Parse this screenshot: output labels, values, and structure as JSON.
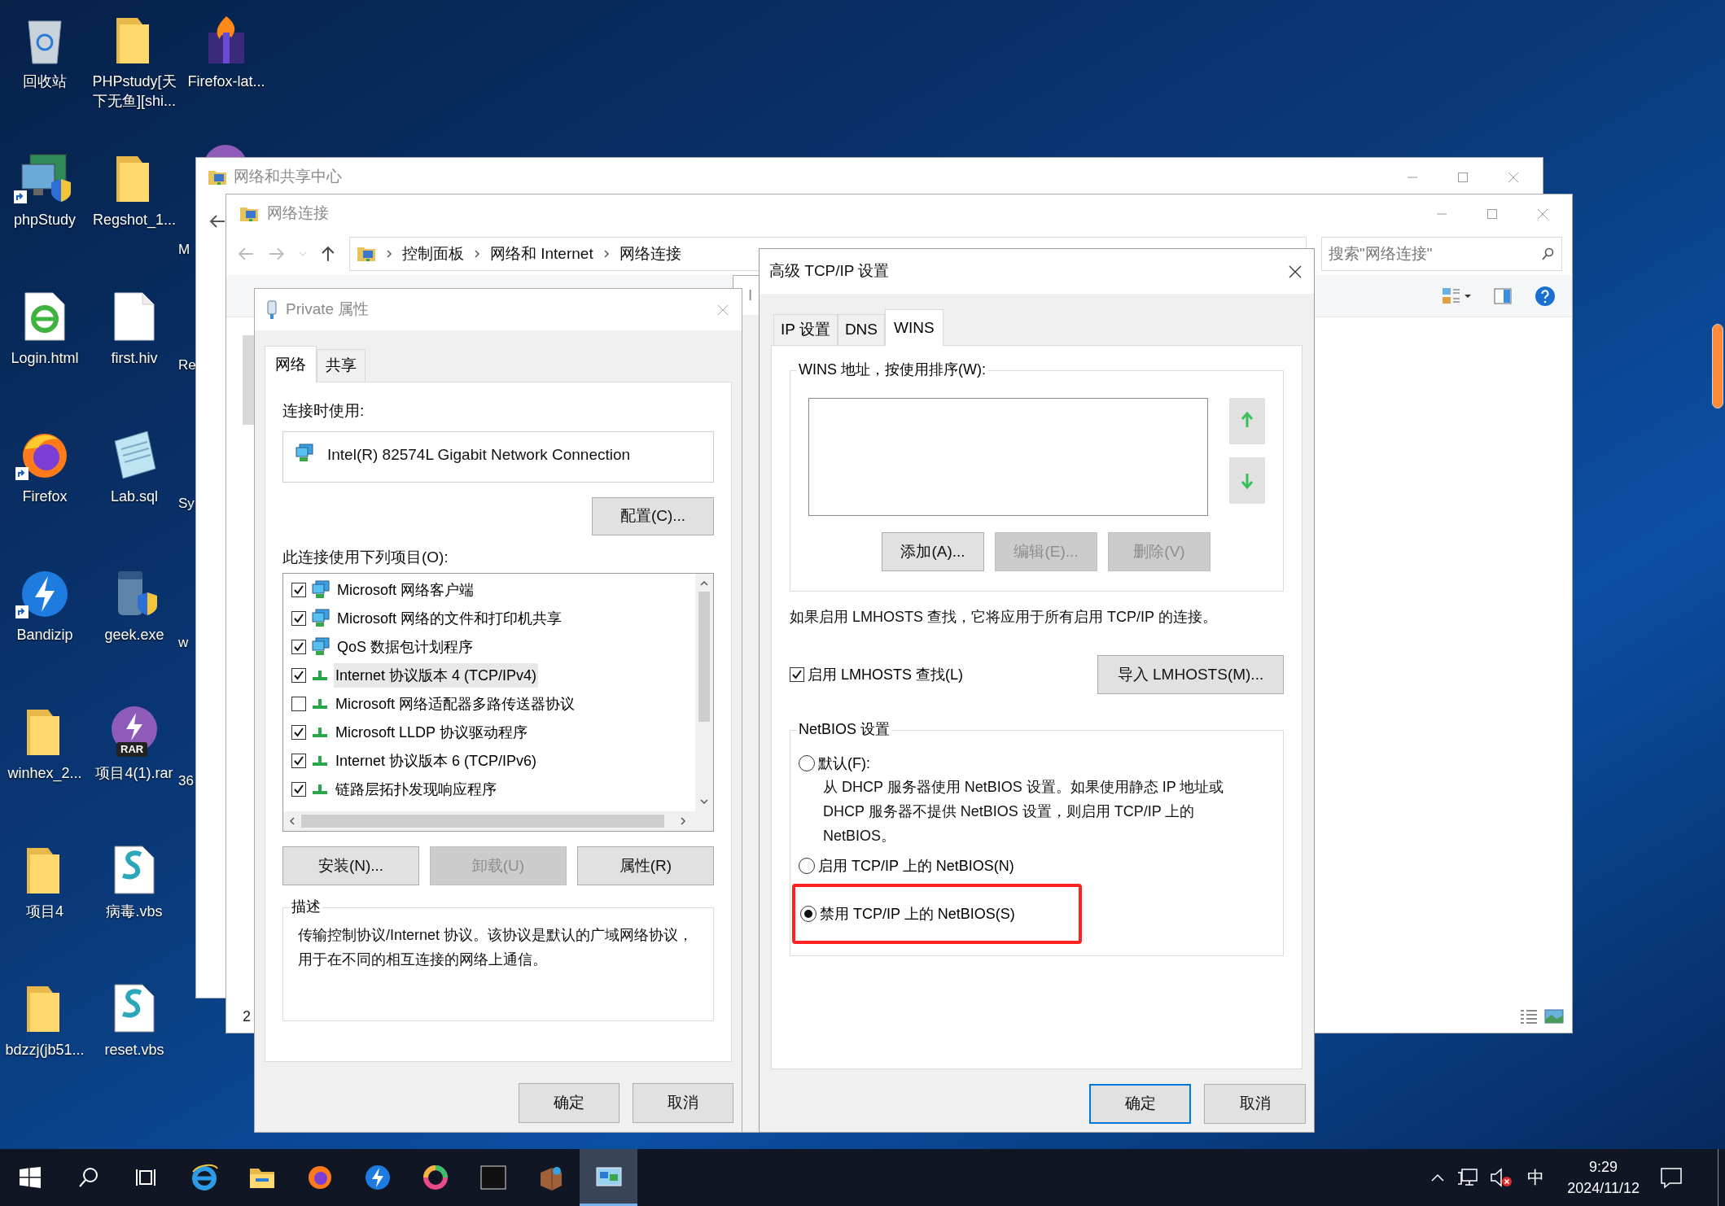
{
  "desktop_icons": [
    {
      "label": "回收站",
      "kind": "bin",
      "shortcut": false
    },
    {
      "label": "phpStudy",
      "kind": "computer",
      "shortcut": true
    },
    {
      "label": "Login.html",
      "kind": "webpage",
      "shortcut": false
    },
    {
      "label": "Firefox",
      "kind": "fox",
      "shortcut": true
    },
    {
      "label": "Bandizip",
      "kind": "bolt",
      "shortcut": true
    },
    {
      "label": "winhex_2...",
      "kind": "folder",
      "shortcut": false
    },
    {
      "label": "项目4",
      "kind": "folder",
      "shortcut": false
    },
    {
      "label": "bdzzj(jb51...",
      "kind": "folder",
      "shortcut": false
    },
    {
      "label": "PHPstudy[天下无鱼][shi...",
      "kind": "folder",
      "shortcut": false
    },
    {
      "label": "Regshot_1...",
      "kind": "folder",
      "shortcut": false
    },
    {
      "label": "first.hiv",
      "kind": "page",
      "shortcut": false
    },
    {
      "label": "Lab.sql",
      "kind": "notepad",
      "shortcut": false
    },
    {
      "label": "geek.exe",
      "kind": "cleaner",
      "shortcut": false
    },
    {
      "label": "项目4(1).rar",
      "kind": "archive",
      "badge": "RAR",
      "shortcut": false
    },
    {
      "label": "病毒.vbs",
      "kind": "script",
      "shortcut": false
    },
    {
      "label": "reset.vbs",
      "kind": "script",
      "shortcut": false
    },
    {
      "label": "Firefox-lat...",
      "kind": "package",
      "shortcut": false
    }
  ],
  "partial_icon_labels": [
    "M",
    "Re",
    "Sy",
    "w",
    "36"
  ],
  "network_center_window": {
    "title": "网络和共享中心"
  },
  "network_connections_window": {
    "title": "网络连接",
    "breadcrumb": [
      "控制面板",
      "网络和 Internet",
      "网络连接"
    ],
    "search": {
      "placeholder": "搜索\"网络连接\""
    },
    "status_count": "2"
  },
  "background_dialog": {
    "title": "I"
  },
  "properties_dialog": {
    "title": "Private 属性",
    "tabs": [
      {
        "label": "网络",
        "selected": true
      },
      {
        "label": "共享",
        "selected": false
      }
    ],
    "connect_using_label": "连接时使用:",
    "adapter": "Intel(R) 82574L Gigabit Network Connection",
    "configure_button": "配置(C)...",
    "items_label": "此连接使用下列项目(O):",
    "items": [
      {
        "label": "Microsoft 网络客户端",
        "checked": true,
        "selected": false,
        "kind": "computer"
      },
      {
        "label": "Microsoft 网络的文件和打印机共享",
        "checked": true,
        "selected": false,
        "kind": "computer"
      },
      {
        "label": "QoS 数据包计划程序",
        "checked": true,
        "selected": false,
        "kind": "computer"
      },
      {
        "label": "Internet 协议版本 4 (TCP/IPv4)",
        "checked": true,
        "selected": true,
        "kind": "protocol"
      },
      {
        "label": "Microsoft 网络适配器多路传送器协议",
        "checked": false,
        "selected": false,
        "kind": "protocol"
      },
      {
        "label": "Microsoft LLDP 协议驱动程序",
        "checked": true,
        "selected": false,
        "kind": "protocol"
      },
      {
        "label": "Internet 协议版本 6 (TCP/IPv6)",
        "checked": true,
        "selected": false,
        "kind": "protocol"
      },
      {
        "label": "链路层拓扑发现响应程序",
        "checked": true,
        "selected": false,
        "kind": "protocol"
      }
    ],
    "buttons": [
      {
        "label": "安装(N)...",
        "disabled": false
      },
      {
        "label": "卸载(U)",
        "disabled": true
      },
      {
        "label": "属性(R)",
        "disabled": false
      }
    ],
    "description_label": "描述",
    "description": "传输控制协议/Internet 协议。该协议是默认的广域网络协议，用于在不同的相互连接的网络上通信。",
    "footer_buttons": [
      {
        "label": "确定",
        "default": false
      },
      {
        "label": "取消",
        "default": false
      }
    ]
  },
  "advanced_dialog": {
    "title": "高级 TCP/IP 设置",
    "tabs": [
      {
        "label": "IP 设置",
        "selected": false
      },
      {
        "label": "DNS",
        "selected": false
      },
      {
        "label": "WINS",
        "selected": true
      }
    ],
    "wins_group_label": "WINS 地址，按使用排序(W):",
    "wins_buttons": [
      {
        "label": "添加(A)...",
        "disabled": false
      },
      {
        "label": "编辑(E)...",
        "disabled": true
      },
      {
        "label": "删除(V)",
        "disabled": true
      }
    ],
    "lmhosts_note": "如果启用 LMHOSTS 查找，它将应用于所有启用 TCP/IP 的连接。",
    "lmhosts_checkbox": {
      "label": "启用 LMHOSTS 查找(L)",
      "checked": true
    },
    "import_button": "导入 LMHOSTS(M)...",
    "netbios_group_label": "NetBIOS 设置",
    "netbios_options": [
      {
        "label": "默认(F):",
        "selected": false,
        "highlighted": false,
        "description": "从 DHCP 服务器使用 NetBIOS 设置。如果使用静态 IP 地址或 DHCP 服务器不提供 NetBIOS 设置，则启用 TCP/IP 上的 NetBIOS。"
      },
      {
        "label": "启用 TCP/IP 上的 NetBIOS(N)",
        "selected": false,
        "highlighted": false
      },
      {
        "label": "禁用 TCP/IP 上的 NetBIOS(S)",
        "selected": true,
        "highlighted": true
      }
    ],
    "footer_buttons": [
      {
        "label": "确定",
        "default": true
      },
      {
        "label": "取消",
        "default": false
      }
    ]
  },
  "taskbar": {
    "apps": [
      {
        "kind": "search",
        "active": false
      },
      {
        "kind": "taskview",
        "active": false
      },
      {
        "kind": "ebrowser",
        "active": false
      },
      {
        "kind": "folder",
        "active": false
      },
      {
        "kind": "fox",
        "active": false
      },
      {
        "kind": "bolt",
        "active": false
      },
      {
        "kind": "ring",
        "active": false
      },
      {
        "kind": "terminal",
        "active": false
      },
      {
        "kind": "box",
        "active": false
      },
      {
        "kind": "network",
        "active": true
      }
    ],
    "ime": "中",
    "time": "9:29",
    "date": "2024/11/12"
  }
}
